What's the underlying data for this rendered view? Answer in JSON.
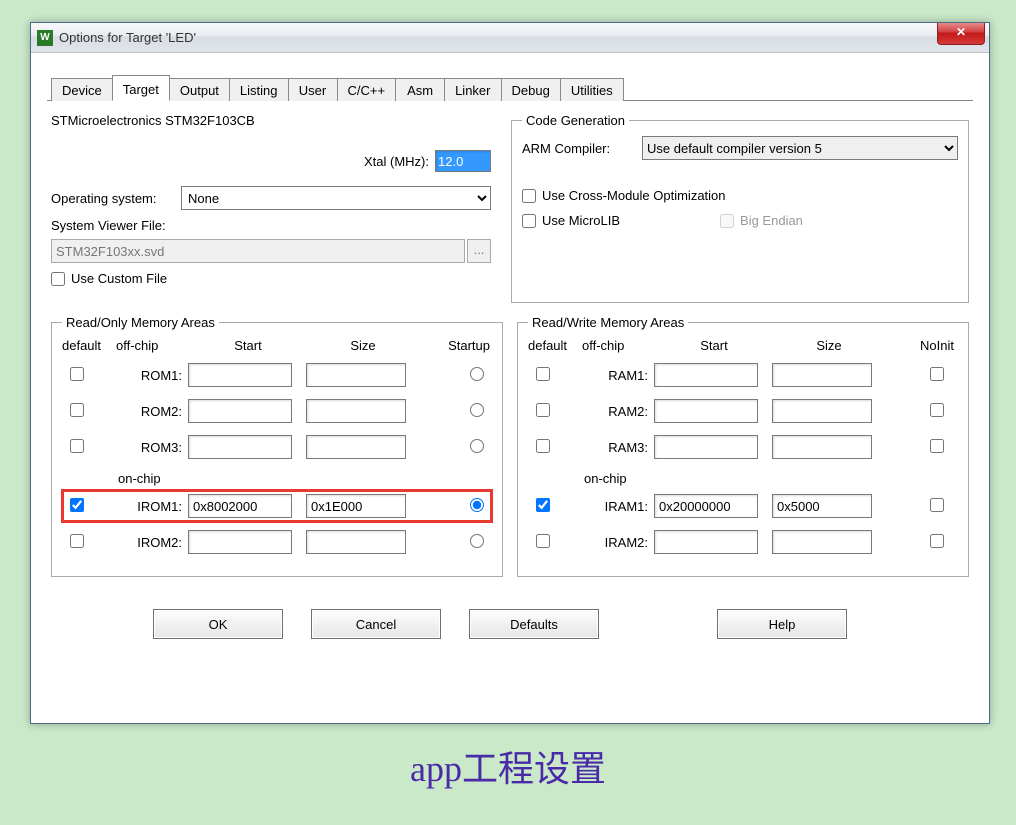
{
  "window": {
    "title": "Options for Target 'LED'",
    "close_glyph": "✕"
  },
  "tabs": {
    "device": "Device",
    "target": "Target",
    "output": "Output",
    "listing": "Listing",
    "user": "User",
    "ccpp": "C/C++",
    "asm": "Asm",
    "linker": "Linker",
    "debug": "Debug",
    "utilities": "Utilities"
  },
  "target_tab": {
    "device_name": "STMicroelectronics STM32F103CB",
    "xtal_label": "Xtal (MHz):",
    "xtal_value": "12.0",
    "os_label": "Operating system:",
    "os_value": "None",
    "svf_label": "System Viewer File:",
    "svf_value": "STM32F103xx.svd",
    "custom_file": "Use Custom File"
  },
  "codegen": {
    "legend": "Code Generation",
    "compiler_label": "ARM Compiler:",
    "compiler_value": "Use default compiler version 5",
    "cross_module": "Use Cross-Module Optimization",
    "microlib": "Use MicroLIB",
    "big_endian": "Big Endian"
  },
  "mem_ro": {
    "legend": "Read/Only Memory Areas",
    "hdr_default": "default",
    "hdr_offchip": "off-chip",
    "hdr_start": "Start",
    "hdr_size": "Size",
    "hdr_startup": "Startup",
    "onchip": "on-chip",
    "rows": [
      {
        "label": "ROM1:",
        "default": false,
        "start": "",
        "size": "",
        "startup": false
      },
      {
        "label": "ROM2:",
        "default": false,
        "start": "",
        "size": "",
        "startup": false
      },
      {
        "label": "ROM3:",
        "default": false,
        "start": "",
        "size": "",
        "startup": false
      }
    ],
    "onchip_rows": [
      {
        "label": "IROM1:",
        "default": true,
        "start": "0x8002000",
        "size": "0x1E000",
        "startup": true
      },
      {
        "label": "IROM2:",
        "default": false,
        "start": "",
        "size": "",
        "startup": false
      }
    ]
  },
  "mem_rw": {
    "legend": "Read/Write Memory Areas",
    "hdr_default": "default",
    "hdr_offchip": "off-chip",
    "hdr_start": "Start",
    "hdr_size": "Size",
    "hdr_noinit": "NoInit",
    "onchip": "on-chip",
    "rows": [
      {
        "label": "RAM1:",
        "default": false,
        "start": "",
        "size": "",
        "noinit": false
      },
      {
        "label": "RAM2:",
        "default": false,
        "start": "",
        "size": "",
        "noinit": false
      },
      {
        "label": "RAM3:",
        "default": false,
        "start": "",
        "size": "",
        "noinit": false
      }
    ],
    "onchip_rows": [
      {
        "label": "IRAM1:",
        "default": true,
        "start": "0x20000000",
        "size": "0x5000",
        "noinit": false
      },
      {
        "label": "IRAM2:",
        "default": false,
        "start": "",
        "size": "",
        "noinit": false
      }
    ]
  },
  "buttons": {
    "ok": "OK",
    "cancel": "Cancel",
    "defaults": "Defaults",
    "help": "Help"
  },
  "caption": "app工程设置"
}
